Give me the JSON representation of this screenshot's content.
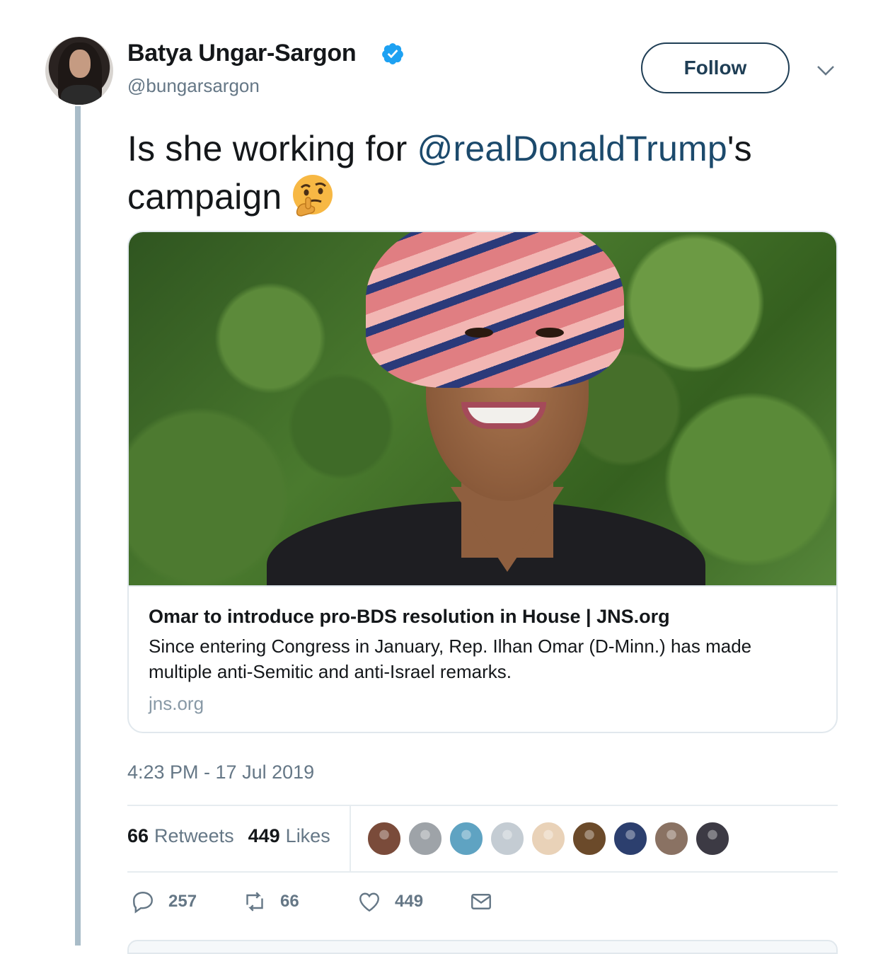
{
  "author": {
    "display_name": "Batya Ungar-Sargon",
    "handle": "@bungarsargon",
    "verified": true
  },
  "follow_button": {
    "label": "Follow"
  },
  "tweet": {
    "text_before": "Is she working for ",
    "mention": "@realDonaldTrump",
    "text_after": "'s campaign",
    "emoji": "thinking-face-emoji"
  },
  "link_card": {
    "title": "Omar to introduce pro-BDS resolution in House | JNS.org",
    "description": "Since entering Congress in January, Rep. Ilhan Omar (D-Minn.) has made multiple anti-Semitic and anti-Israel remarks.",
    "domain": "jns.org"
  },
  "timestamp": "4:23 PM - 17 Jul 2019",
  "stats": {
    "retweets_count": "66",
    "retweets_label": "Retweets",
    "likes_count": "449",
    "likes_label": "Likes"
  },
  "likers": [
    {
      "color": "#7a4b3a"
    },
    {
      "color": "#9ea3a8"
    },
    {
      "color": "#5fa3c2"
    },
    {
      "color": "#c4ccd3"
    },
    {
      "color": "#e9d2b8"
    },
    {
      "color": "#6b4a2a"
    },
    {
      "color": "#2c3f6e"
    },
    {
      "color": "#8a7263"
    },
    {
      "color": "#3c3a44"
    }
  ],
  "actions": {
    "reply_count": "257",
    "retweet_count": "66",
    "like_count": "449"
  },
  "colors": {
    "mention": "#1c4a6c",
    "verified": "#1da1f2",
    "follow_border": "#1f3e55",
    "thread_line": "#a9bcc8",
    "muted": "#657786"
  }
}
